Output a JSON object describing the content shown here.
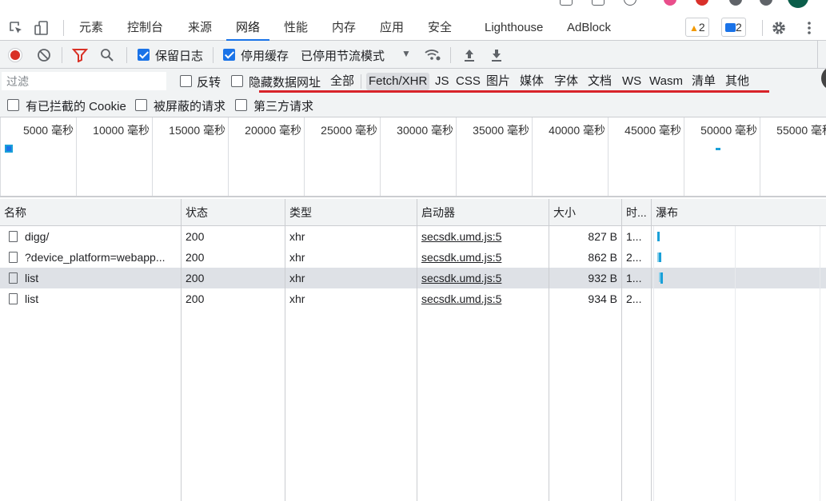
{
  "tabs": [
    {
      "label": "元素"
    },
    {
      "label": "控制台"
    },
    {
      "label": "来源"
    },
    {
      "label": "网络"
    },
    {
      "label": "性能"
    },
    {
      "label": "内存"
    },
    {
      "label": "应用"
    },
    {
      "label": "安全"
    },
    {
      "label": "Lighthouse"
    },
    {
      "label": "AdBlock"
    }
  ],
  "active_tab": "网络",
  "badges": {
    "warnings": "2",
    "messages": "2"
  },
  "toolbar": {
    "preserve_log": "保留日志",
    "disable_cache": "停用缓存",
    "throttling": "已停用节流模式"
  },
  "filter": {
    "placeholder": "过滤",
    "invert": "反转",
    "hide_data_urls": "隐藏数据网址",
    "types": [
      "全部",
      "Fetch/XHR",
      "JS",
      "CSS",
      "图片",
      "媒体",
      "字体",
      "文档",
      "WS",
      "Wasm",
      "清单",
      "其他"
    ],
    "selected_type": "Fetch/XHR"
  },
  "blocked": {
    "blocked_cookies": "有已拦截的 Cookie",
    "blocked_requests": "被屏蔽的请求",
    "third_party": "第三方请求"
  },
  "overview_ticks": [
    "5000 毫秒",
    "10000 毫秒",
    "15000 毫秒",
    "20000 毫秒",
    "25000 毫秒",
    "30000 毫秒",
    "35000 毫秒",
    "40000 毫秒",
    "45000 毫秒",
    "50000 毫秒",
    "55000 毫秒"
  ],
  "columns": {
    "name": "名称",
    "status": "状态",
    "type": "类型",
    "initiator": "启动器",
    "size": "大小",
    "time": "时...",
    "waterfall": "瀑布"
  },
  "rows": [
    {
      "name": "digg/",
      "status": "200",
      "type": "xhr",
      "initiator": "secsdk.umd.js:5",
      "size": "827 B",
      "time": "1..."
    },
    {
      "name": "?device_platform=webapp...",
      "status": "200",
      "type": "xhr",
      "initiator": "secsdk.umd.js:5",
      "size": "862 B",
      "time": "2..."
    },
    {
      "name": "list",
      "status": "200",
      "type": "xhr",
      "initiator": "secsdk.umd.js:5",
      "size": "932 B",
      "time": "1..."
    },
    {
      "name": "list",
      "status": "200",
      "type": "xhr",
      "initiator": "secsdk.umd.js:5",
      "size": "934 B",
      "time": "2..."
    }
  ],
  "colors": {
    "accent": "#1a73e8",
    "record": "#d93025",
    "highlight_underline": "#d8232a",
    "waterfall": "#1aa0d8"
  }
}
